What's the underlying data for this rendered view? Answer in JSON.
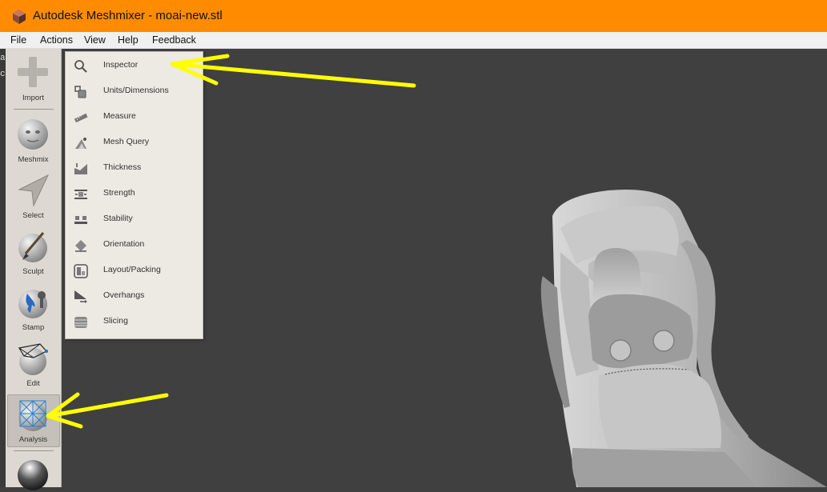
{
  "window": {
    "title": "Autodesk Meshmixer - moai-new.stl",
    "titlebar_color": "#ff8c00"
  },
  "menubar": {
    "items": [
      "File",
      "Actions",
      "View",
      "Help",
      "Feedback"
    ]
  },
  "left_edge_fragments": [
    "a",
    "c"
  ],
  "toolbar": {
    "items": [
      {
        "label": "Import",
        "icon": "plus-icon"
      },
      {
        "label": "Meshmix",
        "icon": "meshmix-head-icon"
      },
      {
        "label": "Select",
        "icon": "select-arrow-icon"
      },
      {
        "label": "Sculpt",
        "icon": "brush-icon"
      },
      {
        "label": "Stamp",
        "icon": "stamp-icon"
      },
      {
        "label": "Edit",
        "icon": "edit-mesh-icon"
      },
      {
        "label": "Analysis",
        "icon": "analysis-mesh-icon",
        "active": true
      }
    ]
  },
  "analysis_menu": {
    "items": [
      {
        "label": "Inspector",
        "icon": "magnifier-icon"
      },
      {
        "label": "Units/Dimensions",
        "icon": "units-icon"
      },
      {
        "label": "Measure",
        "icon": "ruler-icon"
      },
      {
        "label": "Mesh Query",
        "icon": "mesh-query-icon"
      },
      {
        "label": "Thickness",
        "icon": "thickness-icon"
      },
      {
        "label": "Strength",
        "icon": "strength-icon"
      },
      {
        "label": "Stability",
        "icon": "stability-icon"
      },
      {
        "label": "Orientation",
        "icon": "orientation-icon"
      },
      {
        "label": "Layout/Packing",
        "icon": "layout-icon"
      },
      {
        "label": "Overhangs",
        "icon": "overhangs-icon"
      },
      {
        "label": "Slicing",
        "icon": "slicing-icon"
      }
    ]
  },
  "colors": {
    "viewport": "#404040",
    "annotation_arrow": "#ffff00",
    "panel": "#ddd9d2"
  }
}
